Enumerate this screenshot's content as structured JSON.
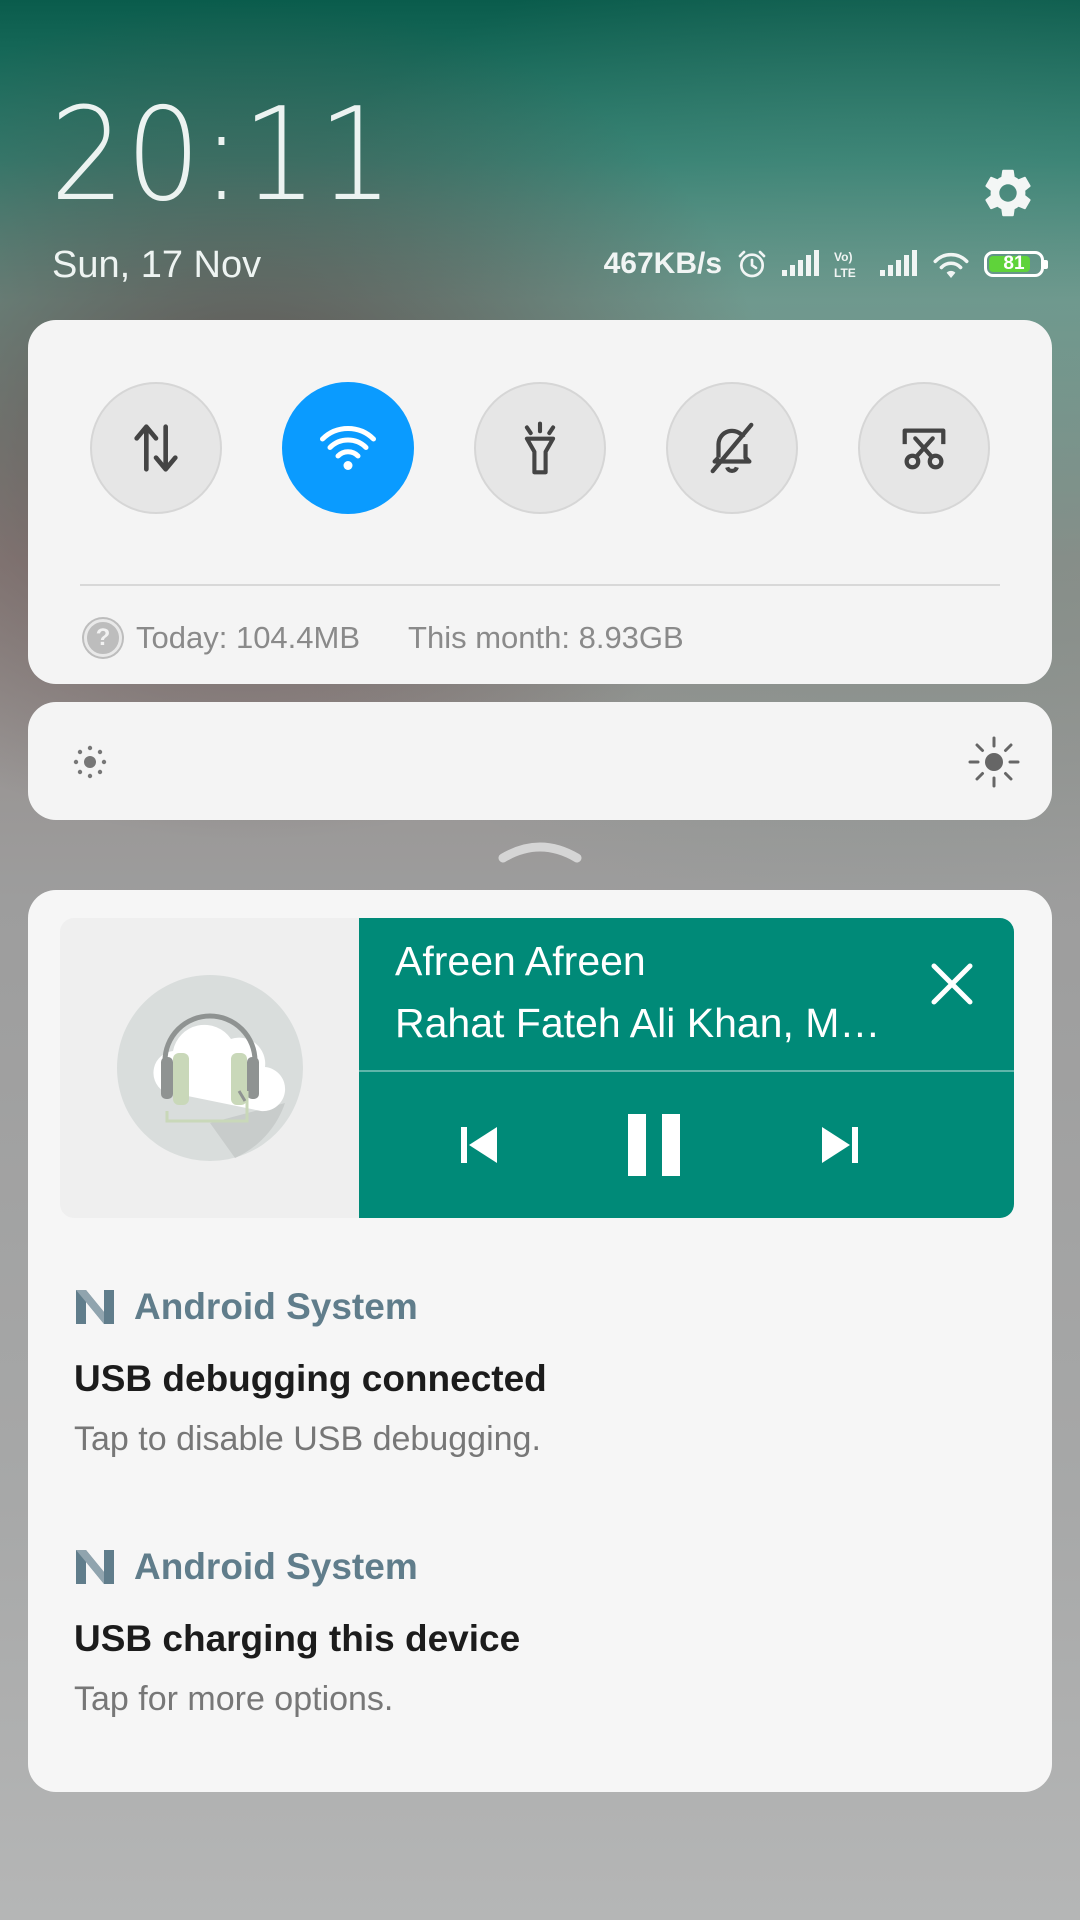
{
  "header": {
    "time": "20:11",
    "date": "Sun, 17 Nov"
  },
  "status_bar": {
    "net_speed": "467KB/s",
    "battery_level": "81",
    "battery_fraction": 0.81,
    "icons": [
      "alarm-icon",
      "signal-icon",
      "volte-icon",
      "signal-icon",
      "wifi-icon",
      "battery-icon"
    ]
  },
  "quick_settings": {
    "toggles": [
      {
        "name": "mobile-data",
        "icon": "data-transfer-icon",
        "active": false
      },
      {
        "name": "wifi",
        "icon": "wifi-icon",
        "active": true
      },
      {
        "name": "flashlight",
        "icon": "flashlight-icon",
        "active": false
      },
      {
        "name": "silent",
        "icon": "bell-off-icon",
        "active": false
      },
      {
        "name": "screenshot",
        "icon": "screenshot-icon",
        "active": false
      }
    ],
    "usage_today": "Today: 104.4MB",
    "usage_month": "This month: 8.93GB"
  },
  "media": {
    "title": "Afreen Afreen",
    "artist": "Rahat Fateh Ali Khan, M…",
    "accent_color": "#008a78"
  },
  "notifications": [
    {
      "app": "Android System",
      "title": "USB debugging connected",
      "body": "Tap to disable USB debugging."
    },
    {
      "app": "Android System",
      "title": "USB charging this device",
      "body": "Tap for more options."
    }
  ],
  "colors": {
    "wifi_active": "#0a9bff",
    "app_name": "#607d8b",
    "battery_green": "#5fd33a"
  }
}
